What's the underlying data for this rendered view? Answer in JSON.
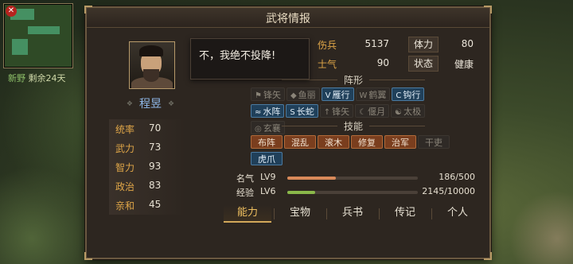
{
  "window": {
    "title": "武将情报"
  },
  "map_hud": {
    "city": "新野",
    "days_label": "剩余24天"
  },
  "hero": {
    "name": "程昱",
    "quote": "不，我绝不投降!"
  },
  "base_stats": [
    {
      "label": "统率",
      "value": "70"
    },
    {
      "label": "武力",
      "value": "73"
    },
    {
      "label": "智力",
      "value": "93"
    },
    {
      "label": "政治",
      "value": "83"
    },
    {
      "label": "亲和",
      "value": "45"
    }
  ],
  "attributes": [
    {
      "label": "伤兵",
      "value": "5137",
      "label2": "体力",
      "value2": "80"
    },
    {
      "label": "士气",
      "value": "90",
      "label2": "状态",
      "value2": "健康"
    }
  ],
  "formation": {
    "title": "阵形",
    "items": [
      {
        "label": "锋矢",
        "icon": "⚑",
        "active": false
      },
      {
        "label": "鱼丽",
        "icon": "◆",
        "active": false
      },
      {
        "label": "雁行",
        "icon": "V",
        "active": true
      },
      {
        "label": "鹤翼",
        "icon": "W",
        "active": false
      },
      {
        "label": "钩行",
        "icon": "C",
        "active": true
      },
      {
        "label": "水阵",
        "icon": "≈",
        "active": true
      },
      {
        "label": "长蛇",
        "icon": "S",
        "active": true
      },
      {
        "label": "锋矢",
        "icon": "↑",
        "active": false
      },
      {
        "label": "偃月",
        "icon": "☾",
        "active": false
      },
      {
        "label": "太极",
        "icon": "☯",
        "active": false
      },
      {
        "label": "玄襄",
        "icon": "◎",
        "active": false
      }
    ]
  },
  "skills": {
    "title": "技能",
    "items": [
      {
        "label": "布阵",
        "style": "on"
      },
      {
        "label": "混乱",
        "style": "on"
      },
      {
        "label": "滚木",
        "style": "on"
      },
      {
        "label": "修复",
        "style": "on"
      },
      {
        "label": "治军",
        "style": "on"
      },
      {
        "label": "干吏",
        "style": "off"
      },
      {
        "label": "虎爪",
        "style": "blue"
      }
    ]
  },
  "fame": {
    "label": "名气",
    "level": "LV9",
    "value": "186/500",
    "progress": 0.372,
    "color": "#d98a5a"
  },
  "exp": {
    "label": "经验",
    "level": "LV6",
    "value": "2145/10000",
    "progress": 0.2145,
    "color": "#8ab84a"
  },
  "tabs": [
    {
      "label": "能力",
      "active": true
    },
    {
      "label": "宝物",
      "active": false
    },
    {
      "label": "兵书",
      "active": false
    },
    {
      "label": "传记",
      "active": false
    },
    {
      "label": "个人",
      "active": false
    }
  ]
}
